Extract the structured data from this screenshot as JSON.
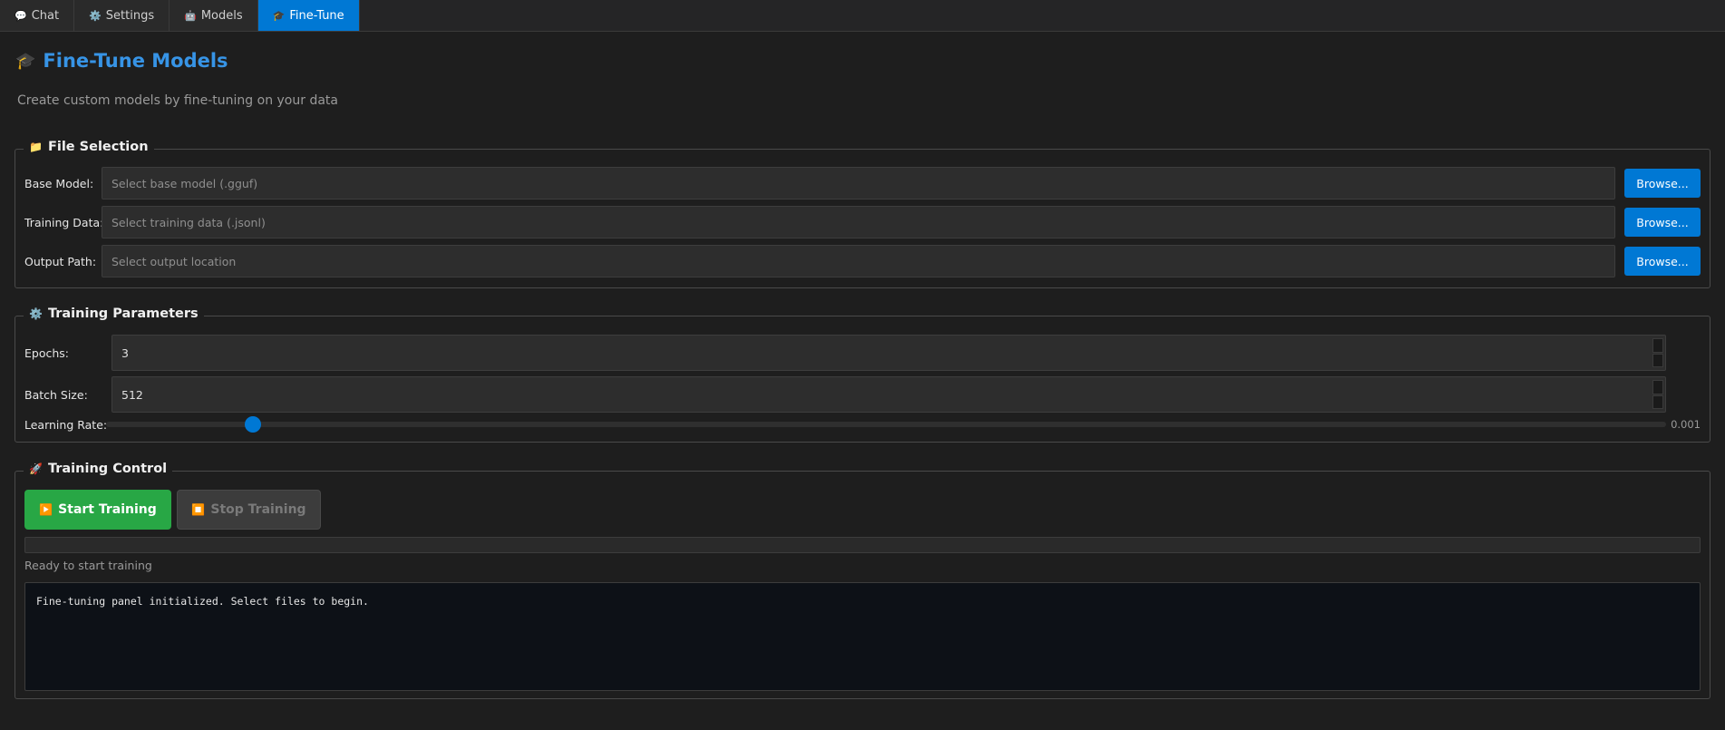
{
  "tabs": [
    {
      "icon": "💬",
      "label": "Chat",
      "active": false
    },
    {
      "icon": "⚙️",
      "label": "Settings",
      "active": false
    },
    {
      "icon": "🤖",
      "label": "Models",
      "active": false
    },
    {
      "icon": "🎓",
      "label": "Fine-Tune",
      "active": true
    }
  ],
  "header": {
    "icon": "🎓",
    "title": "Fine-Tune Models",
    "subtitle": "Create custom models by fine-tuning on your data"
  },
  "file_selection": {
    "icon": "📁",
    "title": "File Selection",
    "rows": [
      {
        "label": "Base Model:",
        "placeholder": "Select base model (.gguf)",
        "button": "Browse..."
      },
      {
        "label": "Training Data:",
        "placeholder": "Select training data (.jsonl)",
        "button": "Browse..."
      },
      {
        "label": "Output Path:",
        "placeholder": "Select output location",
        "button": "Browse..."
      }
    ]
  },
  "training_parameters": {
    "icon": "⚙️",
    "title": "Training Parameters",
    "epochs": {
      "label": "Epochs:",
      "value": "3"
    },
    "batch_size": {
      "label": "Batch Size:",
      "value": "512"
    },
    "learning_rate": {
      "label": "Learning Rate:",
      "value": "0.001",
      "slider_fraction": 0.094
    }
  },
  "training_control": {
    "icon": "🚀",
    "title": "Training Control",
    "start_icon": "▶️",
    "start_label": "Start Training",
    "stop_icon": "⏹️",
    "stop_label": "Stop Training",
    "progress_percent": 0,
    "status": "Ready to start training",
    "log": "Fine-tuning panel initialized. Select files to begin."
  },
  "colors": {
    "accent": "#0078d4",
    "title": "#3794e6",
    "start": "#28a745",
    "background": "#1e1e1e",
    "log_background": "#0d1117"
  }
}
